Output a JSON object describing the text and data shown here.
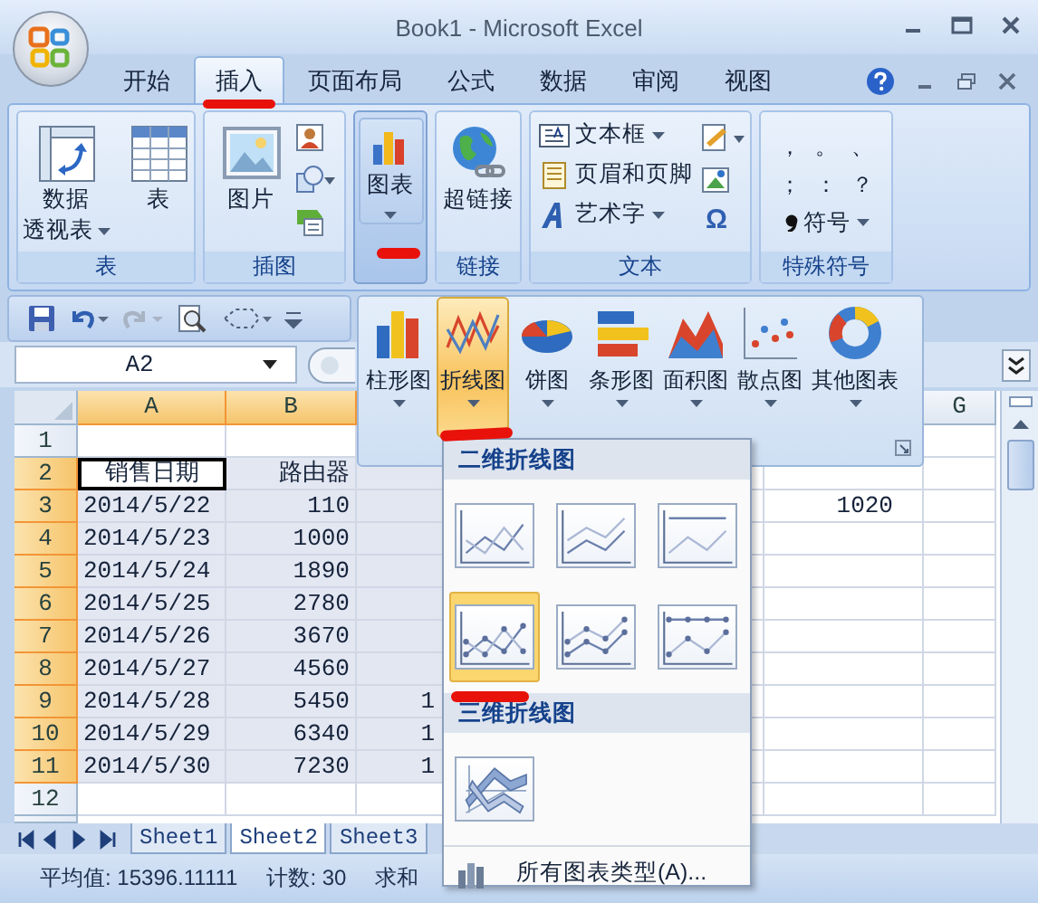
{
  "window": {
    "title": "Book1 - Microsoft Excel"
  },
  "ribbon_tabs": [
    {
      "label": "开始",
      "selected": false
    },
    {
      "label": "插入",
      "selected": true
    },
    {
      "label": "页面布局",
      "selected": false
    },
    {
      "label": "公式",
      "selected": false
    },
    {
      "label": "数据",
      "selected": false
    },
    {
      "label": "审阅",
      "selected": false
    },
    {
      "label": "视图",
      "selected": false
    }
  ],
  "ribbon_groups": [
    {
      "kind": "table",
      "label": "表",
      "buttons": [
        {
          "lines": [
            "数据",
            "透视表"
          ],
          "dropdown": true,
          "pressed": false
        },
        {
          "lines": [
            "表"
          ],
          "dropdown": false,
          "pressed": false
        }
      ]
    },
    {
      "kind": "illustrations",
      "label": "插图",
      "buttons": [
        {
          "lines": [
            "图片"
          ],
          "dropdown": false,
          "pressed": false
        }
      ]
    },
    {
      "kind": "charts",
      "buttons": [
        {
          "lines": [
            "图表"
          ],
          "dropdown": true,
          "pressed": true
        }
      ]
    },
    {
      "kind": "links",
      "label": "链接",
      "buttons": [
        {
          "lines": [
            "超链接"
          ],
          "dropdown": false,
          "pressed": false
        }
      ]
    },
    {
      "kind": "text",
      "label": "文本",
      "symbol_glyph": "Ω",
      "buttons": [
        {
          "lines": [
            "文本框"
          ],
          "dropdown": true,
          "pressed": false
        },
        {
          "lines": [
            "页眉和页脚"
          ],
          "dropdown": false,
          "pressed": false
        },
        {
          "lines": [
            "艺术字"
          ],
          "dropdown": true,
          "pressed": false
        }
      ]
    },
    {
      "kind": "symbols",
      "label": "特殊符号",
      "symbols": [
        "，",
        "。",
        "、",
        "；",
        "：",
        "？"
      ],
      "buttons": [
        {
          "lines": [
            "符号"
          ],
          "dropdown": true,
          "pressed": false
        }
      ]
    }
  ],
  "name_box": {
    "value": "A2"
  },
  "sheet": {
    "columns": [
      {
        "label": "A",
        "selected": true
      },
      {
        "label": "B",
        "selected": true
      },
      {
        "label": "G",
        "selected": false
      }
    ],
    "rows": [
      {
        "header": "1",
        "selected": false
      },
      {
        "header": "2",
        "selected": true,
        "cells": {
          "A": {
            "text": "销售日期",
            "active": true
          },
          "B": {
            "text": "路由器",
            "selected": true,
            "active": false
          },
          "C": {
            "selected": true,
            "active": false
          }
        }
      },
      {
        "header": "3",
        "selected": true,
        "cells": {
          "A": {
            "text": "2014/5/22",
            "selected": true,
            "active": false
          },
          "B": {
            "text": "110",
            "selected": true,
            "active": false
          },
          "C": {
            "selected": true,
            "active": false
          },
          "F": {
            "text": "1020",
            "selected": false,
            "active": false
          }
        }
      },
      {
        "header": "4",
        "selected": true,
        "cells": {
          "A": {
            "text": "2014/5/23",
            "selected": true,
            "active": false
          },
          "B": {
            "text": "1000",
            "selected": true,
            "active": false
          },
          "C": {
            "selected": true,
            "active": false
          }
        }
      },
      {
        "header": "5",
        "selected": true,
        "cells": {
          "A": {
            "text": "2014/5/24",
            "selected": true,
            "active": false
          },
          "B": {
            "text": "1890",
            "selected": true,
            "active": false
          },
          "C": {
            "selected": true,
            "active": false
          }
        }
      },
      {
        "header": "6",
        "selected": true,
        "cells": {
          "A": {
            "text": "2014/5/25",
            "selected": true,
            "active": false
          },
          "B": {
            "text": "2780",
            "selected": true,
            "active": false
          },
          "C": {
            "selected": true,
            "active": false
          }
        }
      },
      {
        "header": "7",
        "selected": true,
        "cells": {
          "A": {
            "text": "2014/5/26",
            "selected": true,
            "active": false
          },
          "B": {
            "text": "3670",
            "selected": true,
            "active": false
          },
          "C": {
            "selected": true,
            "active": false
          }
        }
      },
      {
        "header": "8",
        "selected": true,
        "cells": {
          "A": {
            "text": "2014/5/27",
            "selected": true,
            "active": false
          },
          "B": {
            "text": "4560",
            "selected": true,
            "active": false
          },
          "C": {
            "selected": true,
            "active": false
          }
        }
      },
      {
        "header": "9",
        "selected": true,
        "cells": {
          "A": {
            "text": "2014/5/28",
            "selected": true,
            "active": false
          },
          "B": {
            "text": "5450",
            "selected": true,
            "active": false
          },
          "C": {
            "text": "1",
            "selected": true,
            "active": false
          }
        }
      },
      {
        "header": "10",
        "selected": true,
        "cells": {
          "A": {
            "text": "2014/5/29",
            "selected": true,
            "active": false
          },
          "B": {
            "text": "6340",
            "selected": true,
            "active": false
          },
          "C": {
            "text": "1",
            "selected": true,
            "active": false
          }
        }
      },
      {
        "header": "11",
        "selected": true,
        "cells": {
          "A": {
            "text": "2014/5/30",
            "selected": true,
            "active": false
          },
          "B": {
            "text": "7230",
            "selected": true,
            "active": false
          },
          "C": {
            "text": "1",
            "selected": true,
            "active": false
          }
        }
      },
      {
        "header": "12",
        "selected": false
      }
    ],
    "tabs": [
      {
        "label": "Sheet1",
        "selected": false
      },
      {
        "label": "Sheet2",
        "selected": true
      },
      {
        "label": "Sheet3",
        "selected": false
      }
    ]
  },
  "chart_gallery": {
    "types": [
      {
        "kind": "column",
        "label": "柱形图",
        "selected": false
      },
      {
        "kind": "line",
        "label": "折线图",
        "selected": true
      },
      {
        "kind": "pie",
        "label": "饼图",
        "selected": false
      },
      {
        "kind": "bar",
        "label": "条形图",
        "selected": false
      },
      {
        "kind": "area",
        "label": "面积图",
        "selected": false
      },
      {
        "kind": "scatter",
        "label": "散点图",
        "selected": false
      },
      {
        "kind": "other",
        "label": "其他图表",
        "selected": false
      }
    ]
  },
  "line_menu": {
    "sections": [
      {
        "heading": "二维折线图",
        "styles": [
          {
            "kind": "line",
            "selected": false
          },
          {
            "kind": "stacked",
            "selected": false
          },
          {
            "kind": "percent",
            "selected": false
          },
          {
            "kind": "line-markers",
            "selected": true
          },
          {
            "kind": "stacked-markers",
            "selected": false
          },
          {
            "kind": "percent-markers",
            "selected": false
          }
        ]
      },
      {
        "heading": "三维折线图",
        "styles": [
          {
            "kind": "line-3d",
            "selected": false
          }
        ]
      }
    ],
    "footer": "所有图表类型(A)..."
  },
  "status_bar": {
    "items": [
      "平均值: 15396.11111",
      "计数: 30",
      "求和"
    ]
  }
}
